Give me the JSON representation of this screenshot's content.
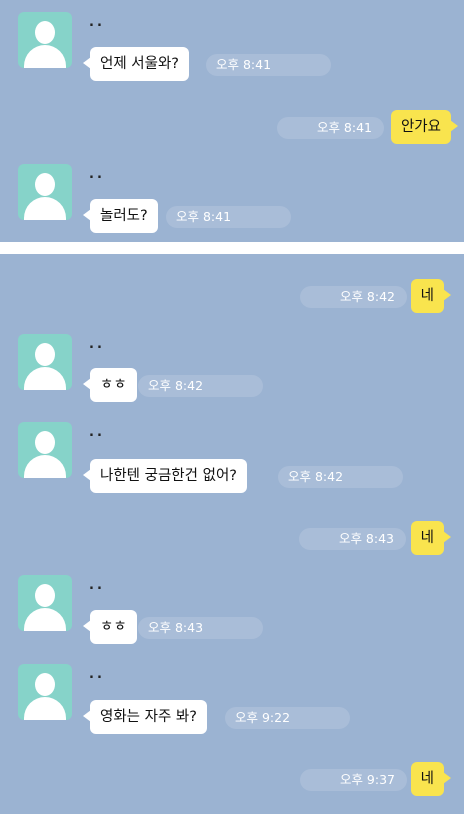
{
  "colors": {
    "chat_background": "#9bb3d2",
    "incoming_bubble": "#ffffff",
    "outgoing_bubble": "#f9e44e",
    "time_pill": "#a9bdd8",
    "avatar": "#86d3c9"
  },
  "sender": {
    "name": "..",
    "avatar_icon": "default-profile-icon"
  },
  "top_panel": {
    "messages": [
      {
        "direction": "incoming",
        "text": "언제 서울와?",
        "time": "오후 8:41"
      },
      {
        "direction": "outgoing",
        "text": "안가요",
        "time": "오후 8:41"
      },
      {
        "direction": "incoming",
        "text": "놀러도?",
        "time": "오후 8:41"
      }
    ]
  },
  "bottom_panel": {
    "messages": [
      {
        "direction": "outgoing",
        "text": "네",
        "time": "오후 8:42"
      },
      {
        "direction": "incoming",
        "text": "ㅎㅎ",
        "time": "오후 8:42"
      },
      {
        "direction": "incoming",
        "text": "나한텐 궁금한건 없어?",
        "time": "오후 8:42"
      },
      {
        "direction": "outgoing",
        "text": "네",
        "time": "오후 8:43"
      },
      {
        "direction": "incoming",
        "text": "ㅎㅎ",
        "time": "오후 8:43"
      },
      {
        "direction": "incoming",
        "text": "영화는 자주 봐?",
        "time": "오후 9:22"
      },
      {
        "direction": "outgoing",
        "text": "네",
        "time": "오후 9:37"
      }
    ]
  }
}
